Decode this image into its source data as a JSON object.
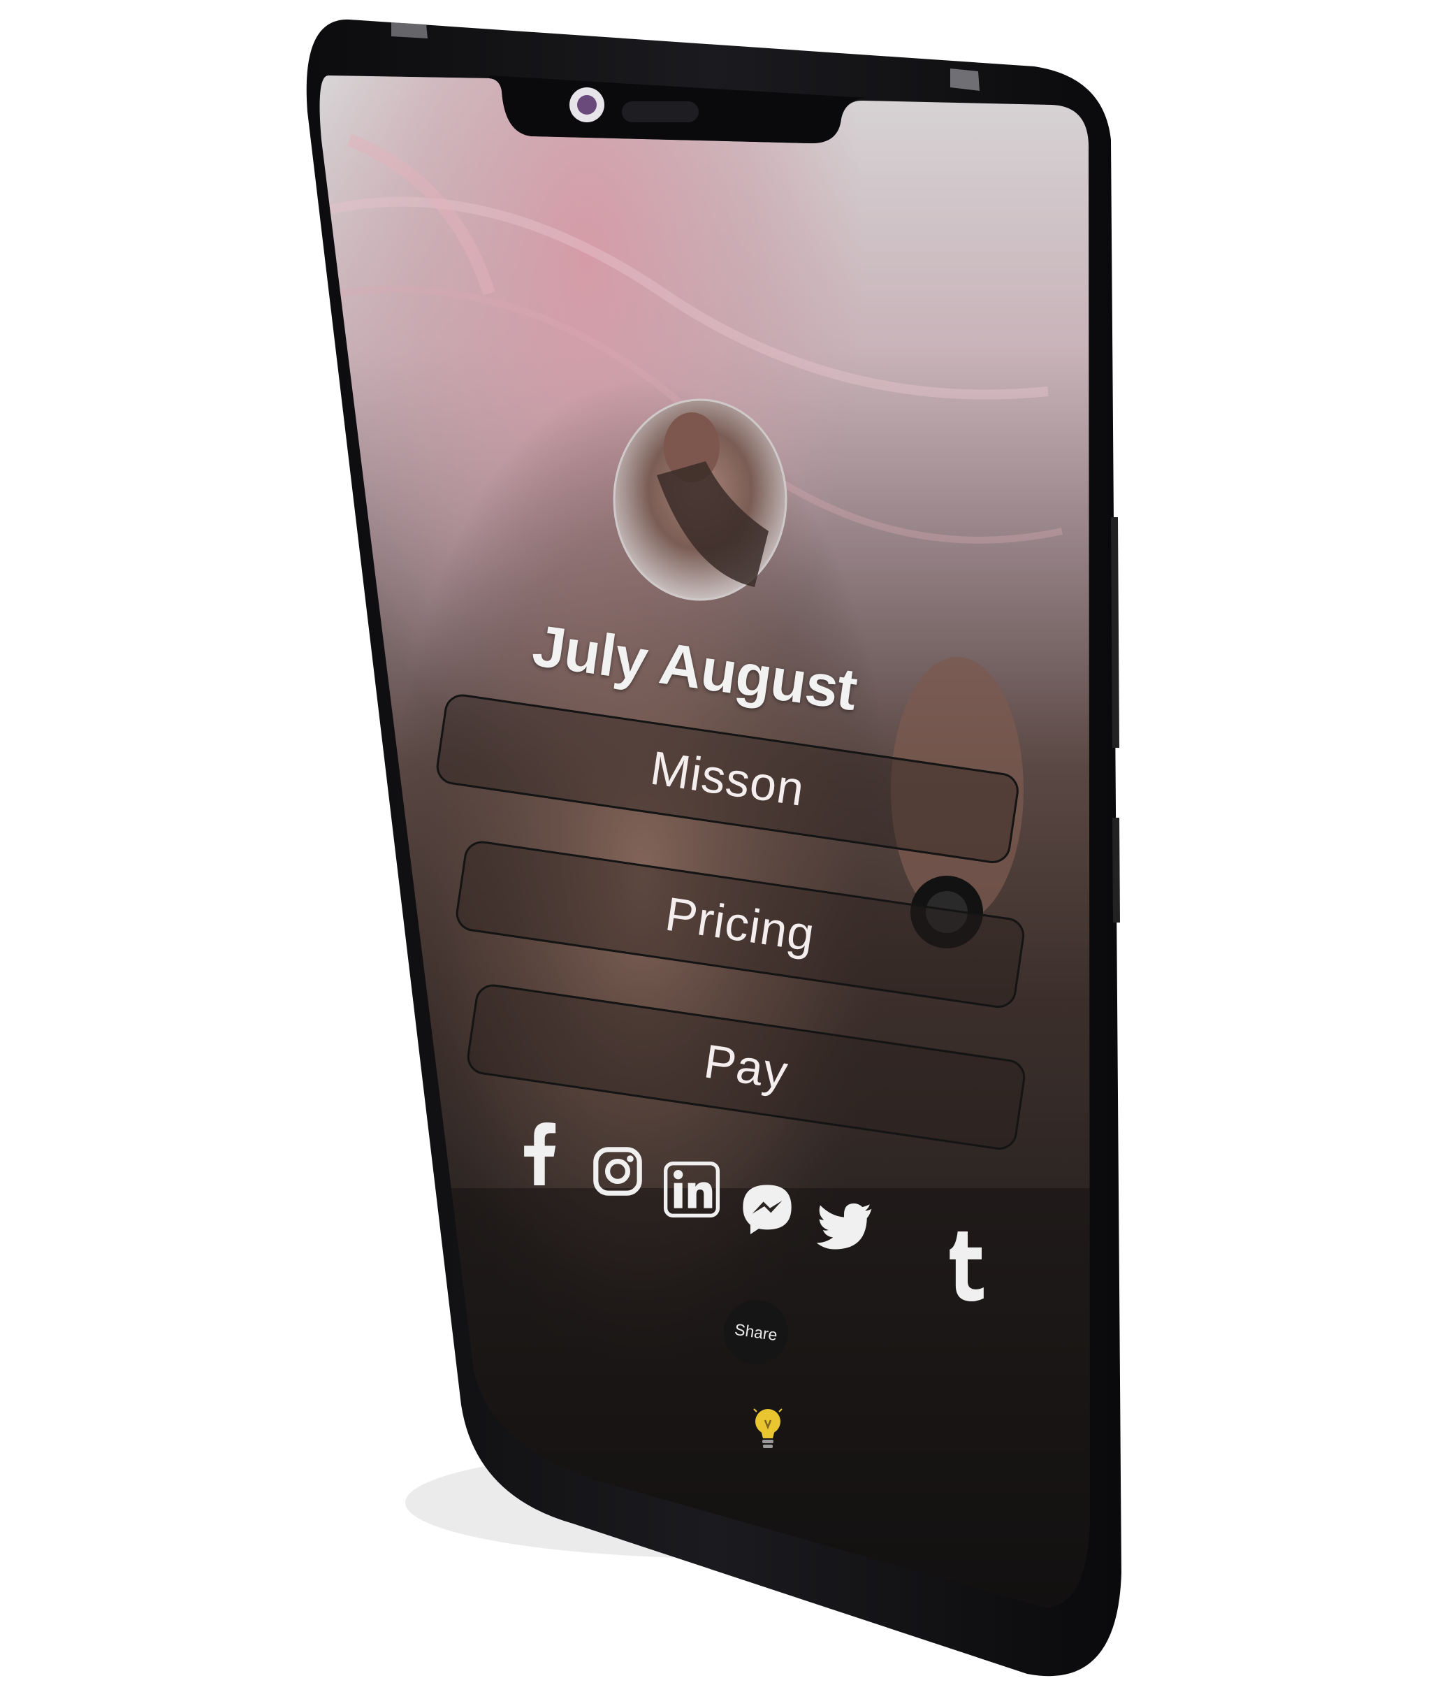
{
  "profile": {
    "name": "July August"
  },
  "menu": {
    "items": [
      {
        "label": "Misson"
      },
      {
        "label": "Pricing"
      },
      {
        "label": "Pay"
      }
    ]
  },
  "social": {
    "icons": [
      "facebook-icon",
      "instagram-icon",
      "linkedin-icon",
      "messenger-icon",
      "twitter-icon",
      "tumblr-icon"
    ],
    "share_label": "Share"
  },
  "colors": {
    "button_border": "#141414",
    "text_light": "#f4eeee",
    "bulb": "#e9c630"
  }
}
